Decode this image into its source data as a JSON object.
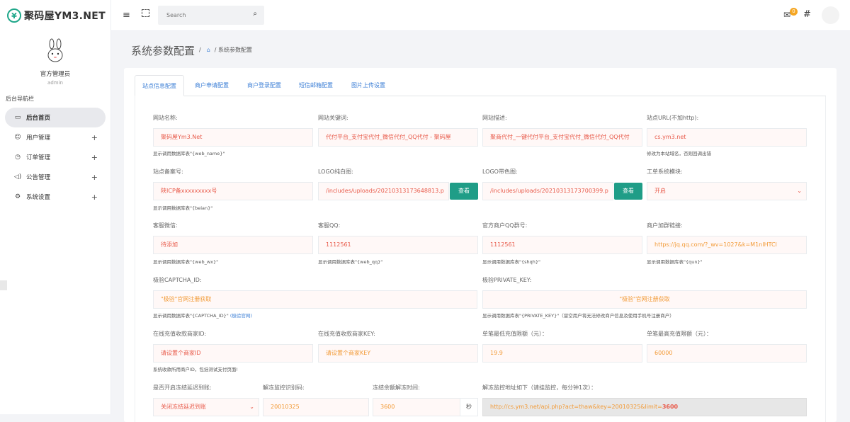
{
  "brand": {
    "name": "聚码屋YM3.NET"
  },
  "profile": {
    "name": "官方管理员",
    "role": "admin"
  },
  "nav": {
    "title": "后台导航栏",
    "items": [
      {
        "label": "后台首页",
        "icon": "monitor-icon"
      },
      {
        "label": "用户管理",
        "icon": "user-icon"
      },
      {
        "label": "订单管理",
        "icon": "clock-icon"
      },
      {
        "label": "公告管理",
        "icon": "speaker-icon"
      },
      {
        "label": "系统设置",
        "icon": "gear-icon"
      }
    ]
  },
  "topbar": {
    "search_placeholder": "Search",
    "mail_badge": "0"
  },
  "page": {
    "title": "系统参数配置",
    "crumb": "系统参数配置"
  },
  "tabs": [
    "站点信息配置",
    "商户申请配置",
    "商户登录配置",
    "短信邮箱配置",
    "图片上传设置"
  ],
  "form": {
    "site_name": {
      "label": "网站名称:",
      "value": "聚码屋Ym3.Net",
      "hint": "显示调用数据库表\"{web_name}\""
    },
    "keywords": {
      "label": "网站关键词:",
      "value": "代付平台_支付宝代付_微信代付_QQ代付 - 聚码屋"
    },
    "description": {
      "label": "网站描述:",
      "value": "聚商代付_一键代付平台_支付宝代付_微信代付_QQ代付"
    },
    "site_url": {
      "label": "站点URL(不加http):",
      "value": "cs.ym3.net",
      "hint": "修改为本站域名，否则回调出错"
    },
    "icp": {
      "label": "站点备案号:",
      "value": "陕ICP备xxxxxxxxx号",
      "hint": "显示调用数据库表\"{beian}\""
    },
    "logo_white": {
      "label": "LOGO纯白图:",
      "value": "/includes/uploads/20210313173648813.p",
      "button": "查看"
    },
    "logo_color": {
      "label": "LOGO带色图:",
      "value": "/includes/uploads/20210313173700399.p",
      "button": "查看"
    },
    "work_module": {
      "label": "工单系统模块:",
      "value": "开启"
    },
    "wechat": {
      "label": "客服微信:",
      "value": "待添加",
      "hint": "显示调用数据库表\"{web_wx}\""
    },
    "qq": {
      "label": "客服QQ:",
      "value": "1112561",
      "hint": "显示调用数据库表\"{web_qq}\""
    },
    "qq_group": {
      "label": "官方商户QQ群号:",
      "value": "1112561",
      "hint": "显示调用数据库表\"{shqh}\""
    },
    "group_link": {
      "label": "商户加群链接:",
      "value": "https://jq.qq.com/?_wv=1027&k=M1nIHTCl",
      "hint": "显示调用数据库表\"{qun}\""
    },
    "captcha_id": {
      "label": "极验CAPTCHA_ID:",
      "value": "\"极验\"官网注册获取",
      "hint": "显示调用数据库表\"{CAPTCHA_ID}\"",
      "hint_link": "(极验官网)"
    },
    "private_key": {
      "label": "极验PRIVATE_KEY:",
      "value": "\"极验\"官网注册获取",
      "hint": "显示调用数据库表\"{PRIVATE_KEY}\"（留空用户将无法修改商户信息及使用手机号注册商户）"
    },
    "merchant_id": {
      "label": "在线充值收款商家ID:",
      "value": "请设置个商家ID",
      "hint": "系统收款所用商户ID，包括测试支付页面!"
    },
    "merchant_key": {
      "label": "在线充值收款商家KEY:",
      "value": "请设置个商家KEY"
    },
    "min_recharge": {
      "label": "单笔最低充值限额（元）：",
      "value": "19.9"
    },
    "max_recharge": {
      "label": "单笔最高充值限额（元）：",
      "value": "60000"
    },
    "freeze": {
      "label": "是否开启冻结延迟到账:",
      "value": "关闭冻结延迟到账"
    },
    "unfreeze_code": {
      "label": "解冻监控识别码:",
      "value": "20010325"
    },
    "unfreeze_time": {
      "label": "冻结余额解冻时间:",
      "value": "3600",
      "unit": "秒"
    },
    "monitor_url": {
      "label": "解冻监控地址如下（请挂监控，每分钟1次）：",
      "value_prefix": "http://cs.ym3.net/api.php?act=thaw&key=20010325&limit=",
      "value_bold": "3600"
    }
  }
}
